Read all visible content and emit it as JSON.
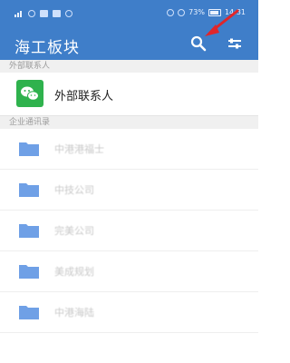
{
  "status_bar": {
    "battery": "73%",
    "time": "14:31"
  },
  "app_bar": {
    "title": "海工板块"
  },
  "sections": {
    "external": "外部联系人",
    "enterprise": "企业通讯录"
  },
  "contact": {
    "label": "外部联系人"
  },
  "folders": [
    {
      "label": "中港港福士"
    },
    {
      "label": "中技公司"
    },
    {
      "label": "完美公司"
    },
    {
      "label": "美成规划"
    },
    {
      "label": "中港海陆"
    }
  ],
  "colors": {
    "header_blue": "#3f7ec9",
    "wechat_green": "#2fb24d",
    "folder_blue": "#6fa0e6",
    "annotation_red": "#e0262a"
  },
  "icons": {
    "search": "search-icon",
    "filter": "sliders-icon",
    "wechat": "wechat-icon",
    "folder": "folder-icon",
    "annotation": "red-arrow-annotation"
  }
}
